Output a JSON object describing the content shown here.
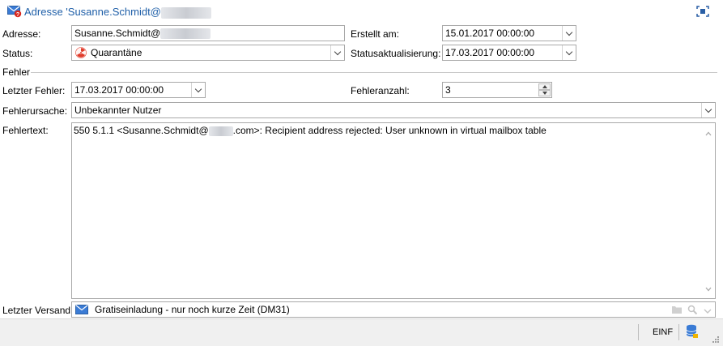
{
  "window": {
    "title_prefix": "Adresse 'Susanne.Schmidt@",
    "icons": {
      "window": "envelope-error-icon",
      "maximize": "maximize-icon"
    }
  },
  "form": {
    "address": {
      "label": "Adresse:",
      "value": "Susanne.Schmidt@"
    },
    "created": {
      "label": "Erstellt am:",
      "value": "15.01.2017 00:00:00"
    },
    "status": {
      "label": "Status:",
      "value": "Quarantäne",
      "icon": "radiation-icon",
      "icon_color": "#e03c2c"
    },
    "status_update": {
      "label": "Statusaktualisierung:",
      "value": "17.03.2017 00:00:00"
    }
  },
  "errors": {
    "group_label": "Fehler",
    "last_error": {
      "label": "Letzter Fehler:",
      "value": "17.03.2017 00:00:00"
    },
    "error_count": {
      "label": "Fehleranzahl:",
      "value": "3"
    },
    "cause": {
      "label": "Fehlerursache:",
      "value": "Unbekannter Nutzer"
    },
    "text": {
      "label": "Fehlertext:",
      "before": "550 5.1.1 <Susanne.Schmidt@",
      "after": ".com>: Recipient address rejected: User unknown in virtual mailbox table"
    }
  },
  "last_send": {
    "label": "Letzter Versand:",
    "value": "Gratiseinladung - nur noch kurze Zeit (DM31)",
    "icon": "envelope-icon"
  },
  "statusbar": {
    "mode": "EINF",
    "icon": "database-icon"
  },
  "colors": {
    "title": "#1f5fa8",
    "border": "#a9a9a9",
    "statusbar_bg": "#f0f0f0"
  }
}
